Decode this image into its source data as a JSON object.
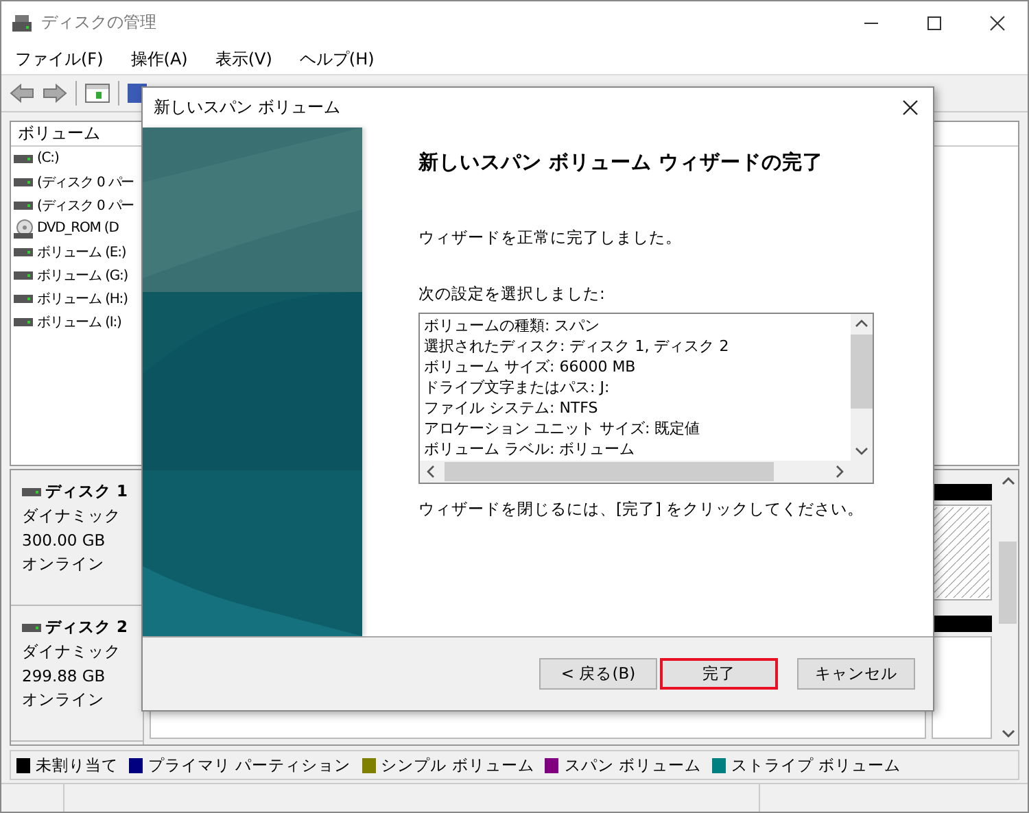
{
  "window": {
    "title": "ディスクの管理"
  },
  "menu": [
    "ファイル(F)",
    "操作(A)",
    "表示(V)",
    "ヘルプ(H)"
  ],
  "volume_list": {
    "columns": [
      "ボリューム"
    ],
    "rows": [
      {
        "name": "(C:)",
        "kind": "disk"
      },
      {
        "name": "(ディスク 0 パー",
        "kind": "disk"
      },
      {
        "name": "(ディスク 0 パー",
        "kind": "disk"
      },
      {
        "name": "DVD_ROM (D",
        "kind": "dvd"
      },
      {
        "name": "ボリューム (E:)",
        "kind": "disk"
      },
      {
        "name": "ボリューム (G:)",
        "kind": "disk"
      },
      {
        "name": "ボリューム (H:)",
        "kind": "disk"
      },
      {
        "name": "ボリューム (I:)",
        "kind": "disk"
      }
    ]
  },
  "disks": [
    {
      "name": "ディスク 1",
      "type": "ダイナミック",
      "size": "300.00 GB",
      "status": "オンライン"
    },
    {
      "name": "ディスク 2",
      "type": "ダイナミック",
      "size": "299.88 GB",
      "status": "オンライン"
    }
  ],
  "legend": [
    {
      "label": "未割り当て",
      "color": "#000000"
    },
    {
      "label": "プライマリ パーティション",
      "color": "#000080"
    },
    {
      "label": "シンプル ボリューム",
      "color": "#808000"
    },
    {
      "label": "スパン ボリューム",
      "color": "#800080"
    },
    {
      "label": "ストライプ ボリューム",
      "color": "#008080"
    }
  ],
  "dialog": {
    "title": "新しいスパン ボリューム",
    "heading": "新しいスパン ボリューム ウィザードの完了",
    "message": "ウィザードを正常に完了しました。",
    "settings_label": "次の設定を選択しました:",
    "settings": [
      "ボリュームの種類: スパン",
      "選択されたディスク: ディスク 1, ディスク 2",
      "ボリューム サイズ: 66000 MB",
      "ドライブ文字またはパス: J:",
      "ファイル システム: NTFS",
      "アロケーション ユニット サイズ: 既定値",
      "ボリューム ラベル: ボリューム"
    ],
    "closing_note": "ウィザードを閉じるには、[完了] をクリックしてください。",
    "buttons": [
      {
        "label": "< 戻る(B)",
        "focused": false
      },
      {
        "label": "完了",
        "focused": true
      },
      {
        "label": "キャンセル",
        "focused": false
      }
    ]
  }
}
